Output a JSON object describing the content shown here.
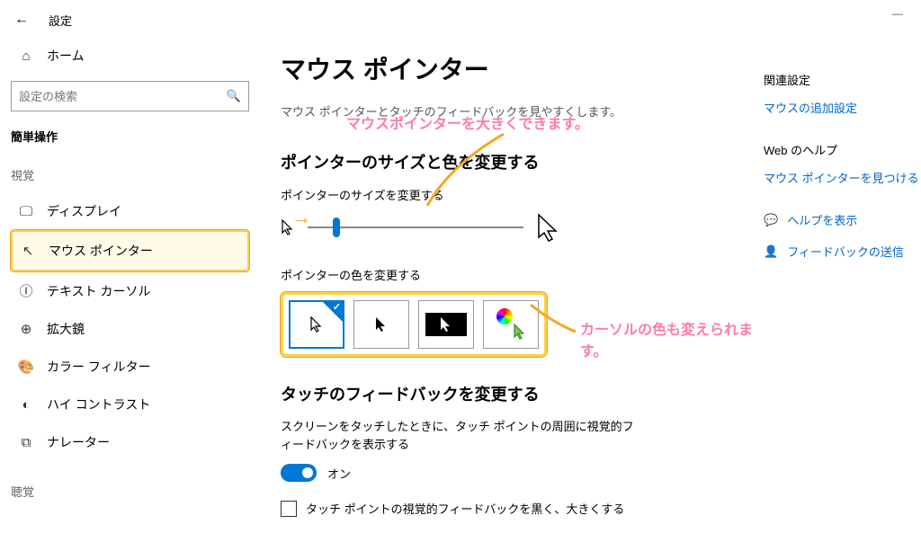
{
  "titlebar": {
    "back": "←",
    "title": "設定"
  },
  "home": {
    "label": "ホーム"
  },
  "search": {
    "placeholder": "設定の検索"
  },
  "section": "簡単操作",
  "subsection_visual": "視覚",
  "subsection_audio": "聴覚",
  "nav": {
    "display": "ディスプレイ",
    "mouse_pointer": "マウス ポインター",
    "text_cursor": "テキスト カーソル",
    "magnifier": "拡大鏡",
    "color_filter": "カラー フィルター",
    "high_contrast": "ハイ コントラスト",
    "narrator": "ナレーター"
  },
  "main": {
    "h1": "マウス ポインター",
    "desc": "マウス ポインターとタッチのフィードバックを見やすくします。",
    "h2_size_color": "ポインターのサイズと色を変更する",
    "slider_label": "ポインターのサイズを変更する",
    "color_label": "ポインターの色を変更する",
    "h2_touch": "タッチのフィードバックを変更する",
    "touch_desc": "スクリーンをタッチしたときに、タッチ ポイントの周囲に視覚的フィードバックを表示する",
    "toggle_on": "オン",
    "checkbox_label": "タッチ ポイントの視覚的フィードバックを黒く、大きくする"
  },
  "right": {
    "related_head": "関連設定",
    "related_link": "マウスの追加設定",
    "web_head": "Web のヘルプ",
    "web_link": "マウス ポインターを見つける",
    "help": "ヘルプを表示",
    "feedback": "フィードバックの送信"
  },
  "annotations": {
    "a1": "マウスポインターを大きくできます。",
    "a2": "カーソルの色も変えられます。"
  }
}
